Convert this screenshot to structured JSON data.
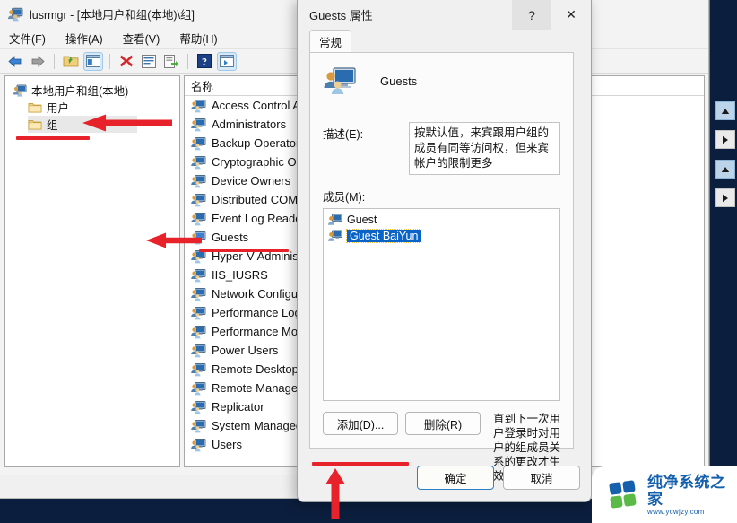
{
  "window": {
    "title": "lusrmgr - [本地用户和组(本地)\\组]",
    "icon": "computer-users-icon",
    "menus": [
      "文件(F)",
      "操作(A)",
      "查看(V)",
      "帮助(H)"
    ],
    "toolbar_buttons": [
      {
        "name": "back-arrow-icon",
        "glyph": "back"
      },
      {
        "name": "forward-arrow-icon",
        "glyph": "forward"
      },
      {
        "name": "up-folder-icon",
        "glyph": "folder"
      },
      {
        "name": "show-hide-tree-icon",
        "glyph": "pane",
        "active": true
      },
      {
        "name": "delete-icon",
        "glyph": "x"
      },
      {
        "name": "properties-icon",
        "glyph": "props"
      },
      {
        "name": "export-list-icon",
        "glyph": "export"
      },
      {
        "name": "help-icon",
        "glyph": "help"
      },
      {
        "name": "show-action-pane-icon",
        "glyph": "pane2",
        "active": true
      }
    ]
  },
  "tree": {
    "root": "本地用户和组(本地)",
    "children": [
      "用户",
      "组"
    ],
    "selected": "组"
  },
  "list": {
    "column_header": "名称",
    "items": [
      "Access Control As",
      "Administrators",
      "Backup Operators",
      "Cryptographic Op",
      "Device Owners",
      "Distributed COM U",
      "Event Log Readers",
      "Guests",
      "Hyper-V Administr",
      "IIS_IUSRS",
      "Network Configura",
      "Performance Log",
      "Performance Mon",
      "Power Users",
      "Remote Desktop U",
      "Remote Managem",
      "Replicator",
      "System Managed",
      "Users"
    ],
    "highlighted": "Guests"
  },
  "dialog": {
    "title": "Guests 属性",
    "help_button": "?",
    "close_button": "✕",
    "tabs": [
      {
        "label": "常规"
      }
    ],
    "group_name": "Guests",
    "description_label": "描述(E):",
    "description_value": "按默认值，来宾跟用户组的成员有同等访问权，但来宾帐户的限制更多",
    "members_label": "成员(M):",
    "members": [
      {
        "name": "Guest",
        "selected": false
      },
      {
        "name": "Guest BaiYun",
        "selected": true
      }
    ],
    "add_button": "添加(D)...",
    "remove_button": "删除(R)",
    "hint": "直到下一次用户登录时对用户的组成员关系的更改才生效。",
    "ok_button": "确定",
    "cancel_button": "取消"
  },
  "annotations": {
    "arrow_color": "#e8222a",
    "marks": [
      "underline-group-tree",
      "arrow-to-group",
      "underline-guests",
      "arrow-to-guests",
      "underline-add-button",
      "arrow-up-to-add"
    ]
  },
  "watermark": {
    "title": "纯净系统之家",
    "url": "www.ycwjzy.com",
    "blue": "#1560ad",
    "green": "#5bba47"
  }
}
